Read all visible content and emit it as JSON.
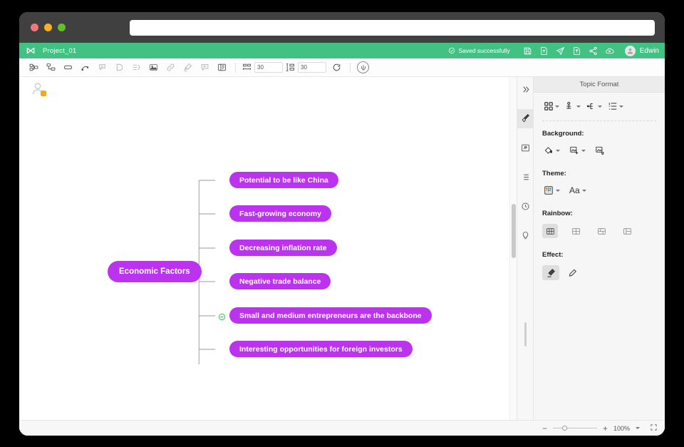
{
  "window": {
    "traffic_lights": [
      "close",
      "minimize",
      "maximize"
    ],
    "address_placeholder": "",
    "address_value": ""
  },
  "appbar": {
    "logo": "mindmaster-logo-icon",
    "project_title": "Project_01",
    "save_status": "Saved successfully",
    "actions": [
      {
        "name": "save-icon",
        "label": "Save"
      },
      {
        "name": "export-icon",
        "label": "Export"
      },
      {
        "name": "send-icon",
        "label": "Send"
      },
      {
        "name": "share-out-icon",
        "label": "Share"
      },
      {
        "name": "share-nodes-icon",
        "label": "Share link"
      },
      {
        "name": "cloud-user-icon",
        "label": "Collaborate"
      }
    ],
    "username": "Edwin"
  },
  "toolbar": {
    "buttons": [
      {
        "name": "subtopic-icon",
        "label": "Subtopic",
        "dim": false
      },
      {
        "name": "topic-after-icon",
        "label": "Topic After",
        "dim": false
      },
      {
        "name": "topic-icon",
        "label": "Topic",
        "dim": false
      },
      {
        "name": "relationship-icon",
        "label": "Relationship",
        "dim": false
      },
      {
        "name": "callout-icon",
        "label": "Callout",
        "dim": true
      },
      {
        "name": "boundary-icon",
        "label": "Boundary",
        "dim": true
      },
      {
        "name": "summary-icon",
        "label": "Summary",
        "dim": true
      },
      {
        "name": "image-icon",
        "label": "Image",
        "dim": false
      },
      {
        "name": "link-icon",
        "label": "Link",
        "dim": true
      },
      {
        "name": "highlighter-icon",
        "label": "Highlighter",
        "dim": true
      },
      {
        "name": "comment-icon",
        "label": "Comment",
        "dim": true
      },
      {
        "name": "note-icon",
        "label": "Note",
        "dim": false
      }
    ],
    "spacing_horizontal": {
      "icon": "horizontal-spacing-icon",
      "value": "30"
    },
    "spacing_vertical": {
      "icon": "vertical-spacing-icon",
      "value": "30"
    },
    "reset_icon": "reset-icon",
    "psi_icon": "psi-icon"
  },
  "canvas": {
    "presence_icon": "presence-avatar-icon",
    "collapse_toggle": "collapse-minus-icon",
    "node_color": "#bb33ee",
    "branch_color": "#888888"
  },
  "mindmap": {
    "root": {
      "text": "Economic Factors"
    },
    "children": [
      {
        "text": "Potential to be like China"
      },
      {
        "text": "Fast-growing economy"
      },
      {
        "text": "Decreasing inflation rate"
      },
      {
        "text": "Negative trade balance"
      },
      {
        "text": "Small and medium entrepreneurs are the backbone"
      },
      {
        "text": "Interesting opportunities for foreign investors"
      }
    ]
  },
  "rail": {
    "items": [
      {
        "name": "expand-panel-icon",
        "label": "Expand",
        "active": false
      },
      {
        "name": "paint-brush-icon",
        "label": "Topic Format",
        "active": true
      },
      {
        "name": "image-frame-icon",
        "label": "Image",
        "active": false
      },
      {
        "name": "outline-list-icon",
        "label": "Outline",
        "active": false
      },
      {
        "name": "history-clock-icon",
        "label": "History",
        "active": false
      },
      {
        "name": "lightbulb-icon",
        "label": "Ideas",
        "active": false
      }
    ]
  },
  "panel": {
    "title": "Topic Format",
    "layout_buttons": [
      {
        "name": "shape-grid-icon",
        "label": "Shape"
      },
      {
        "name": "structure-icon",
        "label": "Structure"
      },
      {
        "name": "branch-style-icon",
        "label": "Branch"
      },
      {
        "name": "numbering-icon",
        "label": "Numbering"
      }
    ],
    "background": {
      "label": "Background:",
      "buttons": [
        {
          "name": "fill-bucket-icon",
          "label": "Fill Color",
          "caret": true
        },
        {
          "name": "add-image-icon",
          "label": "Add Image",
          "caret": true
        },
        {
          "name": "remove-image-icon",
          "label": "Remove Image",
          "caret": false
        }
      ]
    },
    "theme": {
      "label": "Theme:",
      "buttons": [
        {
          "name": "theme-palette-icon",
          "label": "Theme Color",
          "caret": true
        },
        {
          "name": "theme-font-icon",
          "label": "Aa",
          "caret": true
        }
      ]
    },
    "rainbow": {
      "label": "Rainbow:",
      "options": [
        {
          "name": "rainbow-option-1",
          "selected": true
        },
        {
          "name": "rainbow-option-2",
          "selected": false
        },
        {
          "name": "rainbow-option-3",
          "selected": false
        },
        {
          "name": "rainbow-option-4",
          "selected": false
        }
      ]
    },
    "effect": {
      "label": "Effect:",
      "options": [
        {
          "name": "effect-marker-icon",
          "selected": true
        },
        {
          "name": "effect-pen-icon",
          "selected": false
        }
      ]
    }
  },
  "statusbar": {
    "zoom_out": "−",
    "zoom_in": "+",
    "zoom_value": "100%",
    "fullscreen_icon": "fullscreen-icon"
  }
}
